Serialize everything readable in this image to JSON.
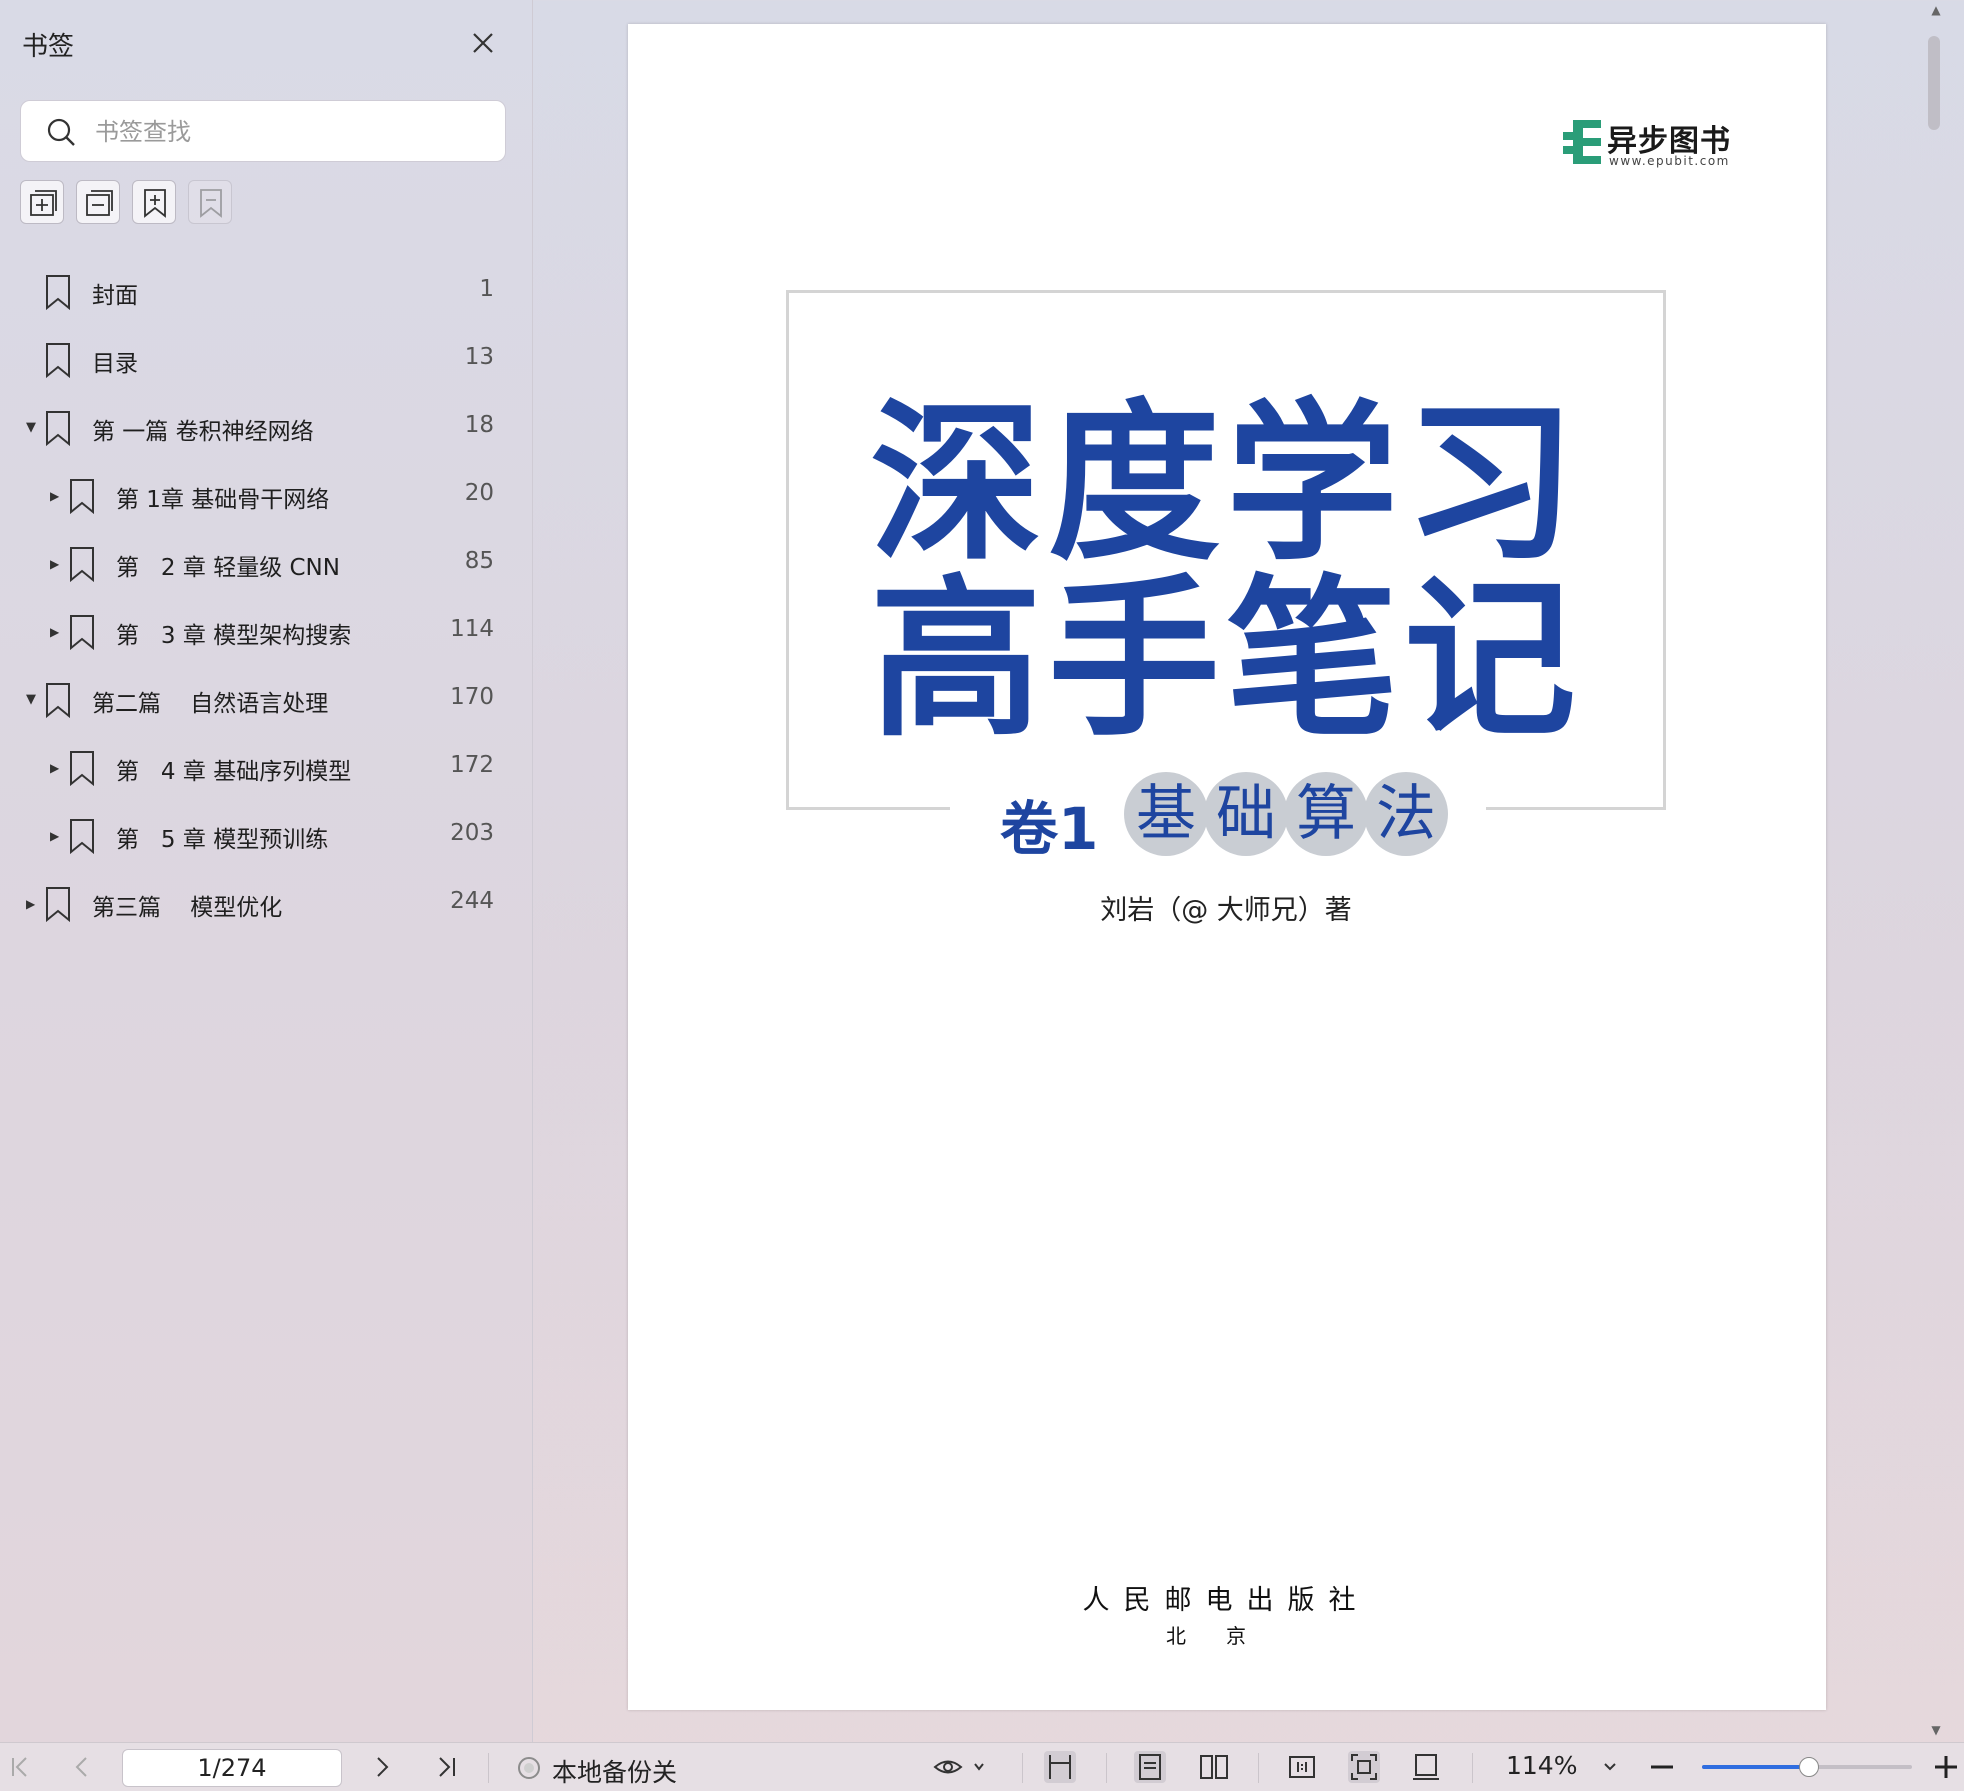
{
  "sidebar": {
    "title": "书签",
    "search_placeholder": "书签查找",
    "bookmarks": [
      {
        "label": "封面",
        "page": "1",
        "level": 0,
        "expander": "none"
      },
      {
        "label": "目录",
        "page": "13",
        "level": 0,
        "expander": "none"
      },
      {
        "label": "第 一篇 卷积神经网络",
        "page": "18",
        "level": 0,
        "expander": "expanded"
      },
      {
        "label": "第 1章 基础骨干网络",
        "page": "20",
        "level": 1,
        "expander": "collapsed"
      },
      {
        "label": "第   2 章 轻量级 CNN",
        "page": "85",
        "level": 1,
        "expander": "collapsed"
      },
      {
        "label": "第   3 章 模型架构搜索",
        "page": "114",
        "level": 1,
        "expander": "collapsed"
      },
      {
        "label": "第二篇    自然语言处理",
        "page": "170",
        "level": 0,
        "expander": "expanded"
      },
      {
        "label": "第   4 章 基础序列模型",
        "page": "172",
        "level": 1,
        "expander": "collapsed"
      },
      {
        "label": "第   5 章 模型预训练",
        "page": "203",
        "level": 1,
        "expander": "collapsed"
      },
      {
        "label": "第三篇    模型优化",
        "page": "244",
        "level": 0,
        "expander": "collapsed"
      }
    ]
  },
  "document": {
    "logo_name": "异步图书",
    "logo_url": "www.epubit.com",
    "title_line1": "深度学习",
    "title_line2": "高手笔记",
    "volume": "卷1",
    "subtitle_chars": [
      "基",
      "础",
      "算",
      "法"
    ],
    "author": "刘岩（@ 大师兄）著",
    "publisher": "人民邮电出版社",
    "city": "北京"
  },
  "toolbar": {
    "page_indicator": "1/274",
    "backup_label": "本地备份关",
    "zoom": "114%",
    "zoom_fraction": 0.51
  },
  "colors": {
    "title_blue": "#1e45a0",
    "logo_green": "#2a9d78",
    "accent": "#2f6de0"
  }
}
